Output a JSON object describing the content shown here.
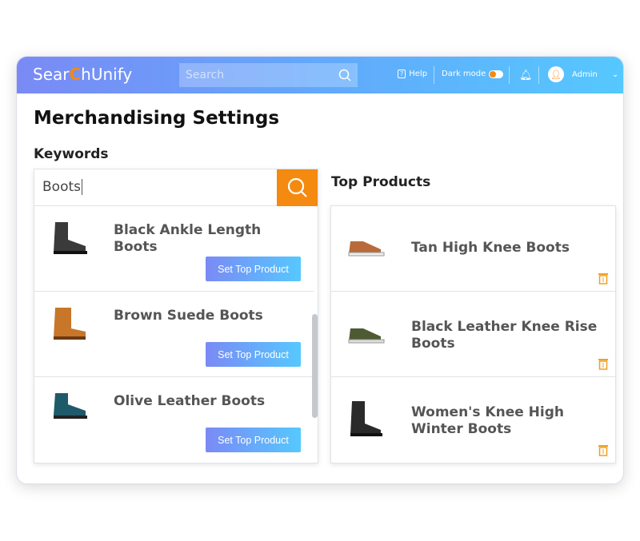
{
  "header": {
    "logo": "SearchUnify",
    "logo_pre": "Sear",
    "logo_c": "C",
    "logo_post": "hUnify",
    "search_placeholder": "Search",
    "help": "Help",
    "dark_mode": "Dark mode",
    "dark_mode_on": false,
    "user": "Admin"
  },
  "page": {
    "title": "Merchandising Settings",
    "keywords_label": "Keywords",
    "keyword_value": "Boots",
    "top_products_label": "Top Products"
  },
  "results": [
    {
      "name": "Black Ankle Length Boots",
      "button": "Set Top Product",
      "color": "#3a3a3a"
    },
    {
      "name": "Brown Suede Boots",
      "button": "Set Top Product",
      "color": "#c7762a"
    },
    {
      "name": "Olive Leather Boots",
      "button": "Set Top Product",
      "color": "#1f5a6a"
    }
  ],
  "top_products": [
    {
      "name": "Tan High Knee Boots",
      "color": "#b86a3a"
    },
    {
      "name": "Black Leather Knee Rise Boots",
      "color": "#4e5a34"
    },
    {
      "name": "Women's Knee High Winter Boots",
      "color": "#2a2a2a"
    }
  ],
  "colors": {
    "accent": "#f48a10",
    "gradient_start": "#7a8af5",
    "gradient_end": "#56c8fe"
  }
}
